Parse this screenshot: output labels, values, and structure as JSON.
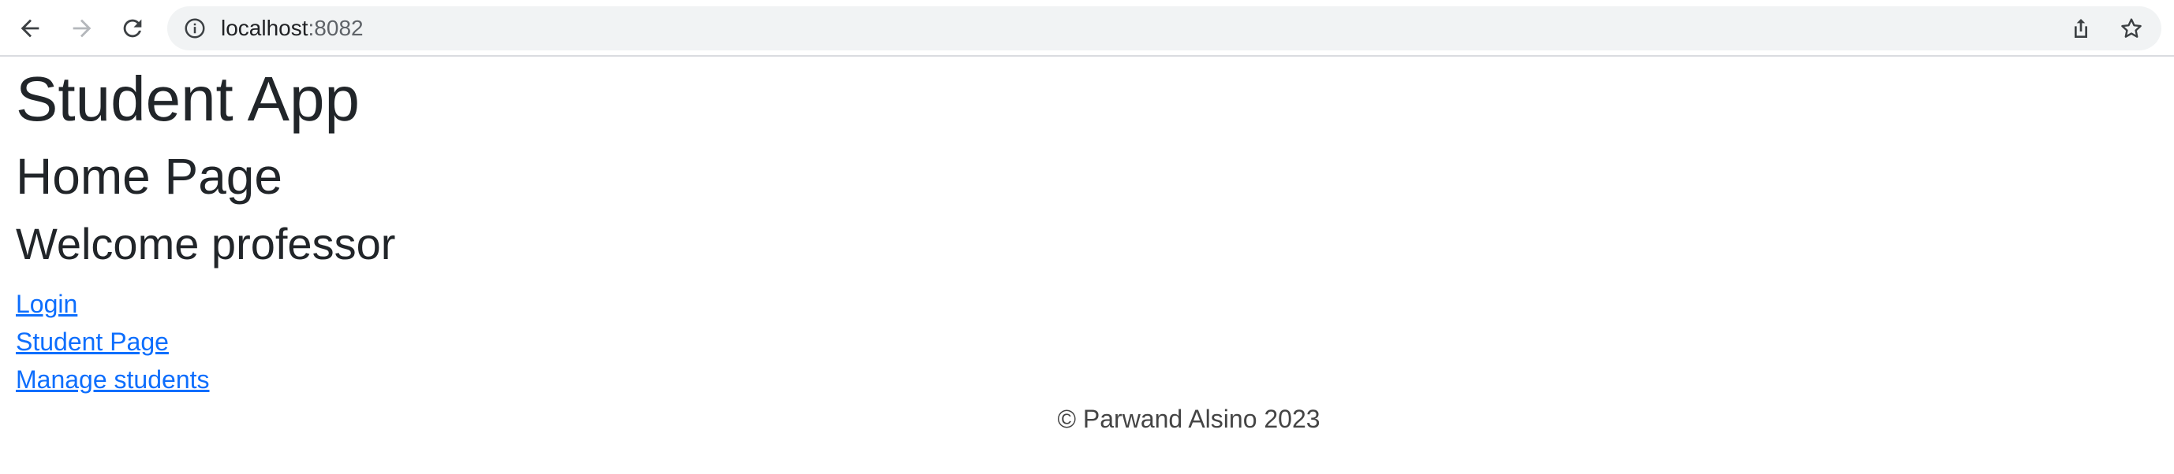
{
  "browser": {
    "url_host": "localhost",
    "url_port": ":8082",
    "icons": {
      "back": "back-arrow-icon",
      "forward": "forward-arrow-icon",
      "reload": "reload-icon",
      "site_info": "info-icon",
      "share": "share-icon",
      "bookmark": "star-icon"
    }
  },
  "page": {
    "app_title": "Student App",
    "heading": "Home Page",
    "welcome": "Welcome professor",
    "links": [
      {
        "label": "Login"
      },
      {
        "label": "Student Page"
      },
      {
        "label": "Manage students"
      }
    ],
    "footer": "© Parwand Alsino 2023"
  },
  "colors": {
    "link": "#0d6efd",
    "text": "#212529",
    "footer_text": "#444444",
    "omnibox_bg": "#f1f3f4"
  }
}
